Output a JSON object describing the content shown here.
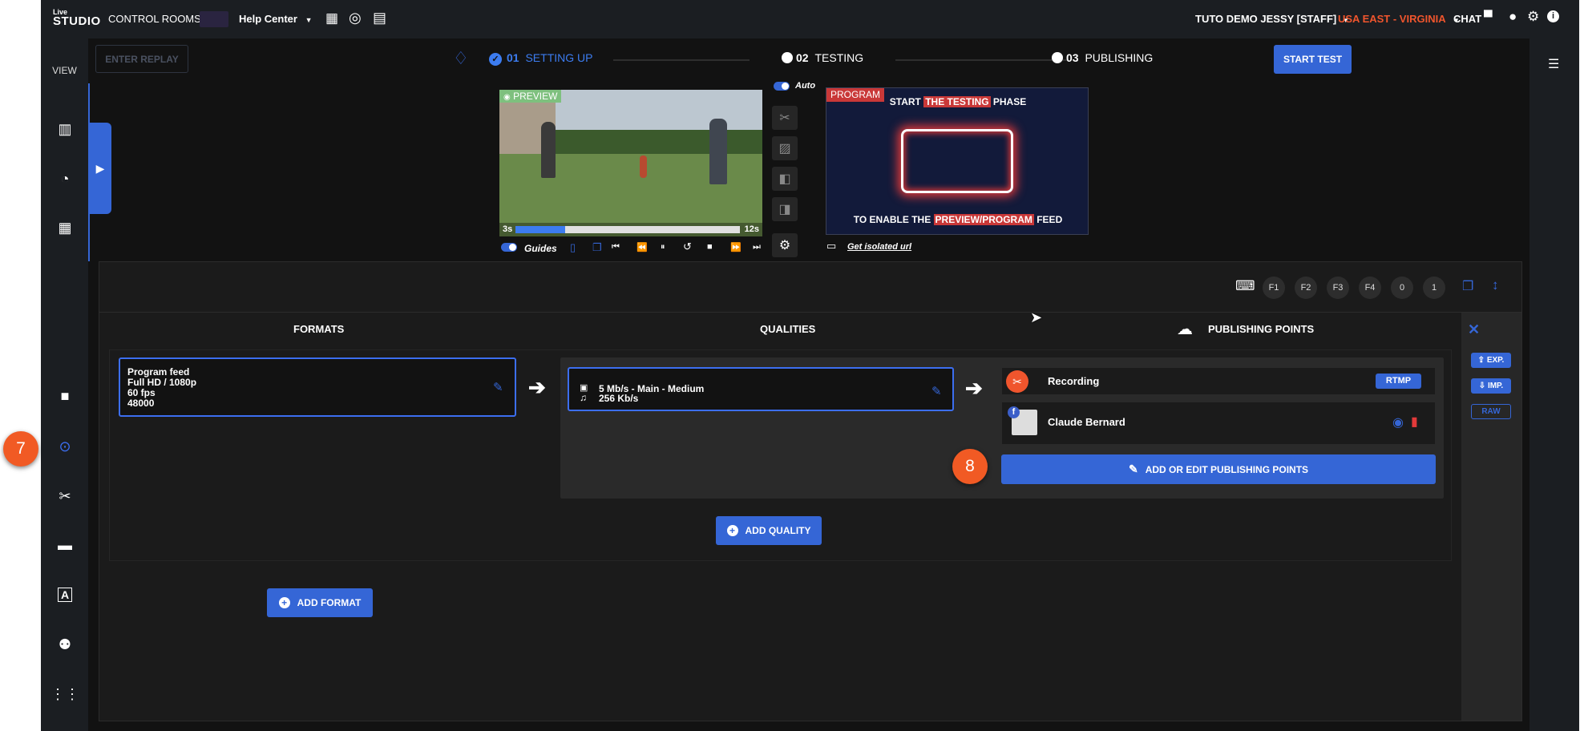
{
  "topbar": {
    "logo_line1": "Live",
    "logo_line2": "STUDIO",
    "control_rooms": "CONTROL ROOMS",
    "help_center": "Help Center",
    "account": "TUTO DEMO JESSY [STAFF]",
    "region": "USA EAST - VIRGINIA",
    "chat": "CHAT",
    "colors": {
      "accent": "#3566d6",
      "region": "#f0552d",
      "callout": "#f15a24"
    }
  },
  "sidebar": {
    "view_label": "VIEW",
    "icons": [
      "chart-icon",
      "speedometer-icon",
      "dashboard-icon",
      "camera-icon",
      "broadcast-icon",
      "scissors-icon",
      "subtitles-icon",
      "text-icon",
      "users-icon",
      "sliders-icon"
    ]
  },
  "steps": {
    "enter_replay": "ENTER REPLAY",
    "step1_num": "01",
    "step1_label": "SETTING UP",
    "step2_num": "02",
    "step2_label": "TESTING",
    "step3_num": "03",
    "step3_label": "PUBLISHING",
    "start_test": "START TEST"
  },
  "preview": {
    "label": "PREVIEW",
    "time_start": "3s",
    "time_end": "12s",
    "progress": 0.22,
    "guides_label": "Guides",
    "auto_label": "Auto"
  },
  "program": {
    "label": "PROGRAM",
    "line1_a": "START ",
    "line1_b": "THE TESTING",
    "line1_c": " PHASE",
    "line2_a": "TO ENABLE THE ",
    "line2_b": "PREVIEW/PROGRAM",
    "line2_c": " FEED",
    "isolated_url": "Get isolated url"
  },
  "shortcuts": [
    "F1",
    "F2",
    "F3",
    "F4",
    "0",
    "1"
  ],
  "columns": {
    "formats": "FORMATS",
    "qualities": "QUALITIES",
    "publishing": "PUBLISHING POINTS"
  },
  "format_card": {
    "name": "Program feed",
    "resolution": "Full HD / 1080p",
    "fps": "60 fps",
    "rate": "48000"
  },
  "quality_card": {
    "video": "5 Mb/s - Main - Medium",
    "audio": "256 Kb/s"
  },
  "publishing_points": [
    {
      "name": "Recording",
      "badge": "RTMP"
    },
    {
      "name": "Claude Bernard"
    }
  ],
  "buttons": {
    "add_edit_publishing": "ADD OR EDIT PUBLISHING POINTS",
    "add_quality": "ADD QUALITY",
    "add_format": "ADD FORMAT",
    "exp": "EXP.",
    "imp": "IMP.",
    "raw": "RAW"
  },
  "callouts": {
    "seven": "7",
    "eight": "8"
  }
}
